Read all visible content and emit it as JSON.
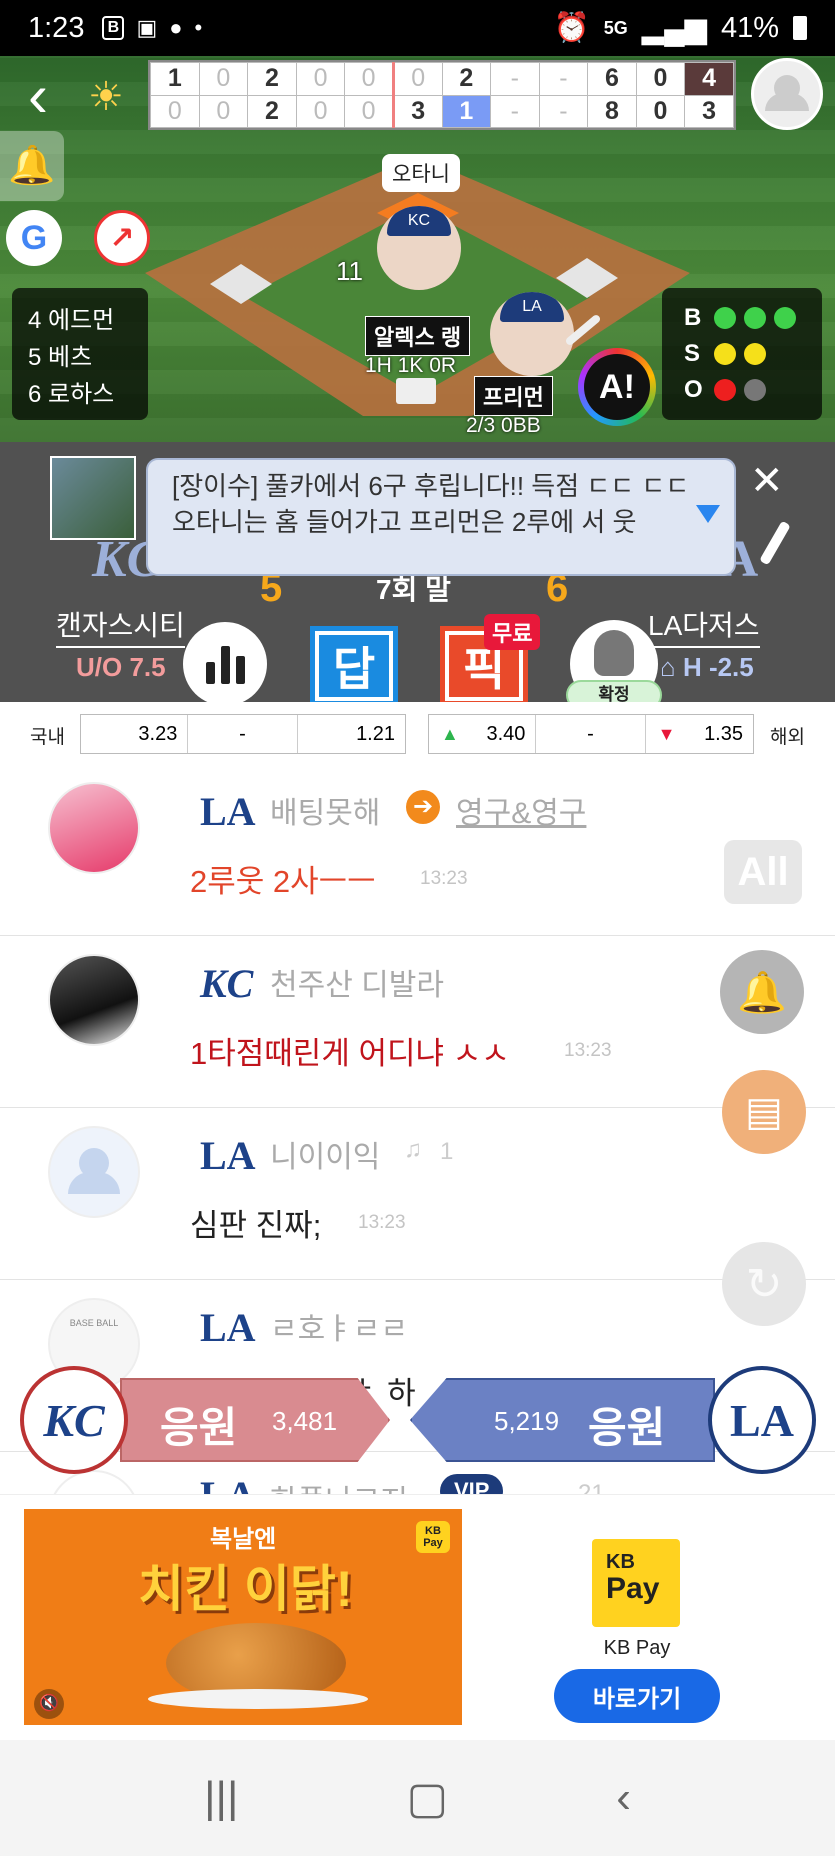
{
  "status_bar": {
    "time": "1:23",
    "network": "5G",
    "battery": "41%"
  },
  "scoreboard": {
    "away_innings": [
      "1",
      "0",
      "2",
      "0",
      "0",
      "0",
      "2",
      "-",
      "-"
    ],
    "away_rhe": [
      "6",
      "0",
      "4"
    ],
    "home_innings": [
      "0",
      "0",
      "2",
      "0",
      "0",
      "3",
      "1",
      "-",
      "-"
    ],
    "home_rhe": [
      "8",
      "0",
      "3"
    ]
  },
  "field": {
    "runner_on_base": "오타니",
    "runner_number": "11",
    "pitcher_name": "알렉스 랭",
    "pitcher_stats": "1H 1K 0R",
    "batter_name": "프리먼",
    "batter_stats": "2/3 0BB",
    "lineup": [
      "4 에드먼",
      "5 베츠",
      "6 로하스"
    ],
    "bso_labels": [
      "B",
      "S",
      "O"
    ],
    "ai_label": "A!",
    "google_label": "G"
  },
  "notice": {
    "text": "[장이수] 풀카에서 6구 후립니다!!   득점 ㄷㄷ ㄷㄷ  오타니는 홈 들어가고 프리먼은 2루에 서 웃"
  },
  "game": {
    "away_team": "캔자스시티",
    "home_team": "LA다저스",
    "away_score": "5",
    "home_score": "6",
    "inning": "7회 말",
    "away_odds_label": "U/O 7.5",
    "home_odds_label": "H -2.5",
    "away_logo": "KC",
    "home_logo": "LA"
  },
  "buttons": {
    "dap": "답",
    "pick": "픽",
    "free_badge": "무료",
    "confirm": "확정"
  },
  "odds": {
    "domestic_label": "국내",
    "domestic": [
      "3.23",
      "-",
      "1.21"
    ],
    "overseas": [
      "3.40",
      "-",
      "1.35"
    ],
    "overseas_label": "해외"
  },
  "chat": [
    {
      "team": "LA",
      "nick": "배팅못해",
      "reply_to": "영구&영구",
      "text": "2루웃 2사ㅡㅡ",
      "time": "13:23",
      "text_color": "#e2452a"
    },
    {
      "team": "KC",
      "nick": "천주산 디발라",
      "text": "1타점때린게 어디냐 ㅅㅅ",
      "time": "13:23",
      "text_color": "#c0141c"
    },
    {
      "team": "LA",
      "nick": "니이이익",
      "bell_count": "1",
      "text": "심판 진짜;",
      "time": "13:23",
      "text_color": "#222"
    },
    {
      "team": "LA",
      "nick": "ㄹ호ㅑㄹㄹ",
      "text": "ㅑ 하",
      "time": "",
      "text_color": "#222"
    },
    {
      "team": "LA",
      "nick": "한풀나그지",
      "badge": "VIP",
      "bell_count": "21",
      "text": "",
      "time": "",
      "text_color": "#222"
    }
  ],
  "side_buttons": {
    "all_label": "All"
  },
  "cheer": {
    "label": "응원",
    "kc_count": "3,481",
    "la_count": "5,219"
  },
  "ad": {
    "headline_small": "복날엔",
    "headline_big": "치킨 이닭!",
    "brand_badge": "KB Pay",
    "brand_logo_top": "KB",
    "brand_logo_bottom": "Pay",
    "brand_name": "KB Pay",
    "cta": "바로가기"
  },
  "colors": {
    "kc_blue": "#1d4289",
    "la_blue": "#1d3b7a",
    "score_orange": "#f6a81b"
  }
}
